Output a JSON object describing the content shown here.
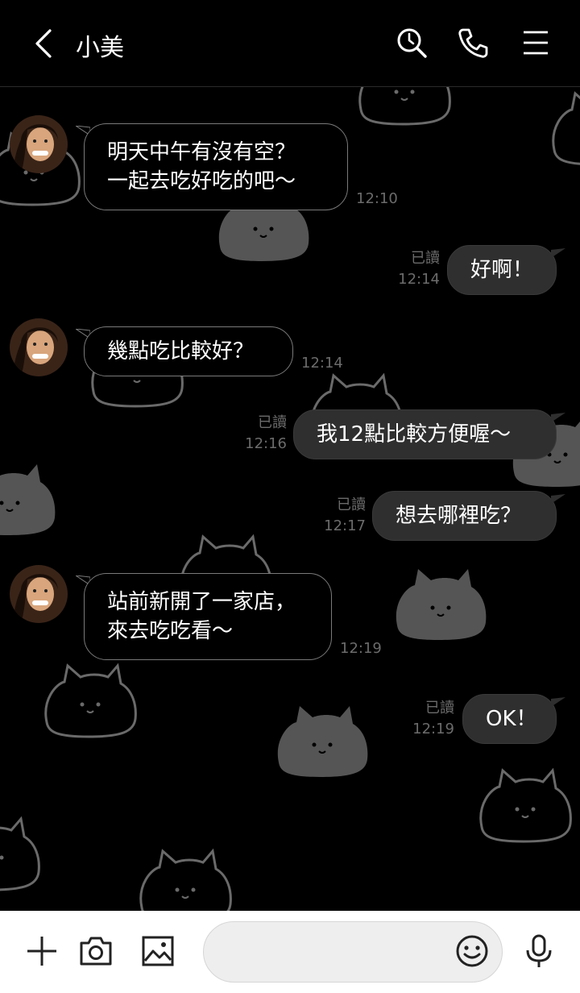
{
  "header": {
    "title": "小美"
  },
  "messages": [
    {
      "side": "in",
      "text": "明天中午有沒有空？\n一起去吃好吃的吧～",
      "time": "12:10"
    },
    {
      "side": "out",
      "text": "好啊！",
      "read": "已讀",
      "time": "12:14"
    },
    {
      "side": "in",
      "text": "幾點吃比較好？",
      "time": "12:14"
    },
    {
      "side": "out",
      "text": "我12點比較方便喔～",
      "read": "已讀",
      "time": "12:16"
    },
    {
      "side": "out",
      "text": "想去哪裡吃？",
      "read": "已讀",
      "time": "12:17"
    },
    {
      "side": "in",
      "text": "站前新開了一家店，\n來去吃吃看～",
      "time": "12:19"
    },
    {
      "side": "out",
      "text": "OK！",
      "read": "已讀",
      "time": "12:19"
    }
  ],
  "colors": {
    "background": "#000000",
    "outgoing_bubble": "#2f2f2f",
    "incoming_border": "#7a7a7a",
    "meta_text": "#6b6b6b",
    "cat_fill": "#555555"
  },
  "icons": {
    "back": "chevron-left-icon",
    "search": "search-clock-icon",
    "call": "phone-icon",
    "menu": "menu-icon",
    "add": "plus-icon",
    "camera": "camera-icon",
    "image": "image-icon",
    "emoji": "smiley-icon",
    "mic": "microphone-icon"
  }
}
